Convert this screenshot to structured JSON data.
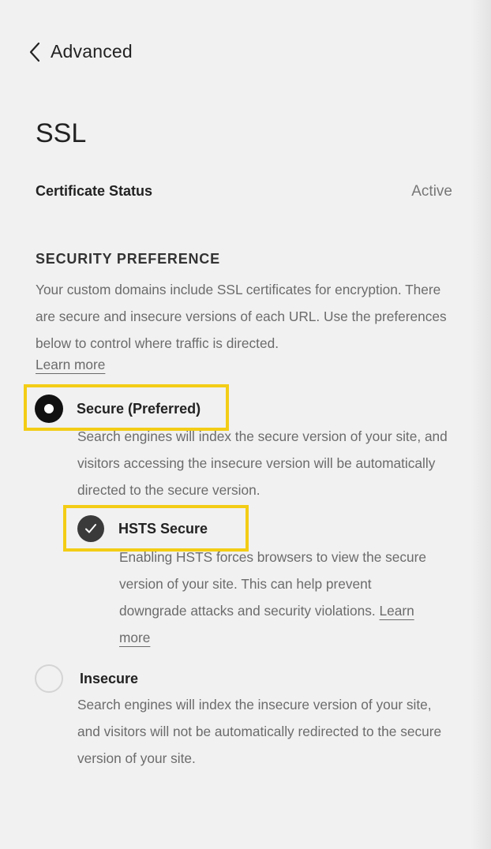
{
  "nav": {
    "back_label": "Advanced",
    "back_icon": "chevron-left-icon"
  },
  "page": {
    "title": "SSL"
  },
  "certificate": {
    "label": "Certificate Status",
    "value": "Active"
  },
  "security": {
    "heading": "SECURITY PREFERENCE",
    "description": "Your custom domains include SSL certificates for encryption. There are secure and insecure versions of each URL. Use the preferences below to control where traffic is directed.",
    "learn_more": "Learn more",
    "options": [
      {
        "label": "Secure (Preferred)",
        "selected": true,
        "description": "Search engines will index the secure version of your site, and visitors accessing the insecure version will be automatically directed to the secure version."
      },
      {
        "label": "HSTS Secure",
        "checked": true,
        "description": "Enabling HSTS forces browsers to view the secure version of your site. This can help prevent downgrade attacks and security violations.",
        "learn_more": "Learn more"
      },
      {
        "label": "Insecure",
        "selected": false,
        "description": "Search engines will index the insecure version of your site, and visitors will not be automatically redirected to the secure version of your site."
      }
    ]
  },
  "colors": {
    "highlight": "#f3cd16",
    "background": "#f1f1f1",
    "muted_text": "#6b6b6b"
  }
}
